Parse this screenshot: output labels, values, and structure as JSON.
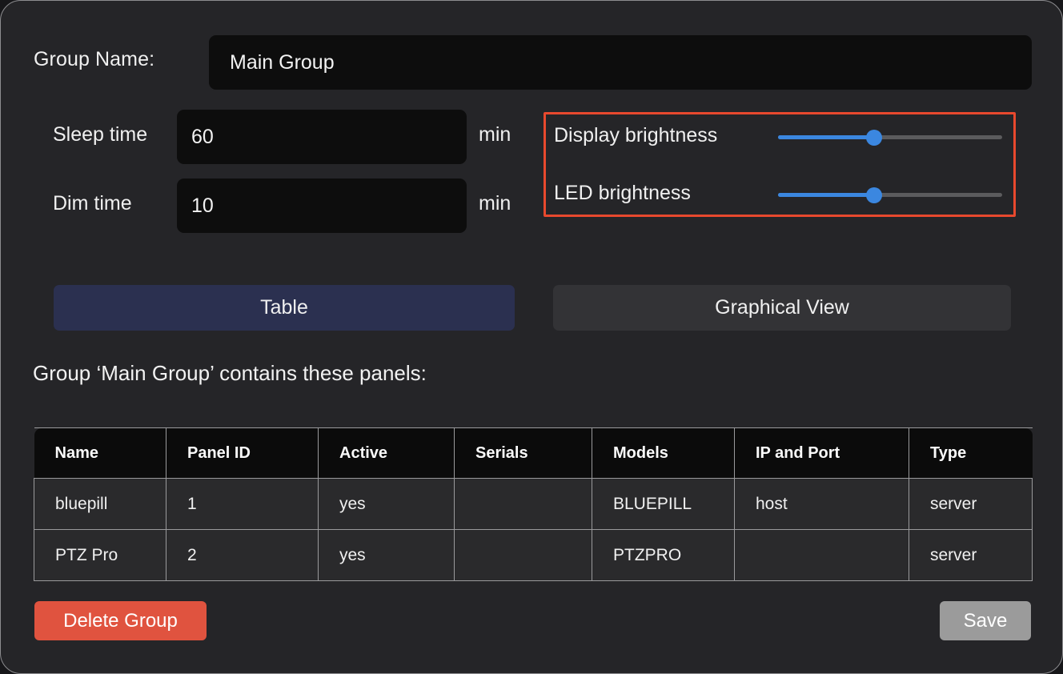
{
  "group_name": {
    "label": "Group Name:",
    "value": "Main Group",
    "placeholder": "Group Name"
  },
  "sleep_time": {
    "label": "Sleep time",
    "value": "60",
    "unit": "min",
    "placeholder": "Sleep time"
  },
  "dim_time": {
    "label": "Dim time",
    "value": "10",
    "unit": "min",
    "placeholder": "Dim time"
  },
  "brightness": {
    "highlight_color": "#e8492e",
    "display": {
      "label": "Display brightness",
      "percent": 43
    },
    "led": {
      "label": "LED brightness",
      "percent": 43
    },
    "slider_fill_color": "#3b87e0",
    "slider_track_color": "#5b5b5d"
  },
  "tabs": [
    {
      "label": "Table",
      "selected": true
    },
    {
      "label": "Graphical View",
      "selected": false
    }
  ],
  "panels_caption": "Group ‘Main Group’ contains these panels:",
  "table": {
    "columns": [
      "Name",
      "Panel ID",
      "Active",
      "Serials",
      "Models",
      "IP and Port",
      "Type"
    ],
    "rows": [
      {
        "name": "bluepill",
        "panel_id": "1",
        "active": "yes",
        "serials": "",
        "models": "BLUEPILL",
        "ip_and_port": "host",
        "type": "server"
      },
      {
        "name": "PTZ Pro",
        "panel_id": "2",
        "active": "yes",
        "serials": "",
        "models": "PTZPRO",
        "ip_and_port": "",
        "type": "server"
      }
    ]
  },
  "footer": {
    "delete_label": "Delete Group",
    "delete_color": "#e0533f",
    "save_label": "Save",
    "save_color": "#9b9b9b"
  }
}
